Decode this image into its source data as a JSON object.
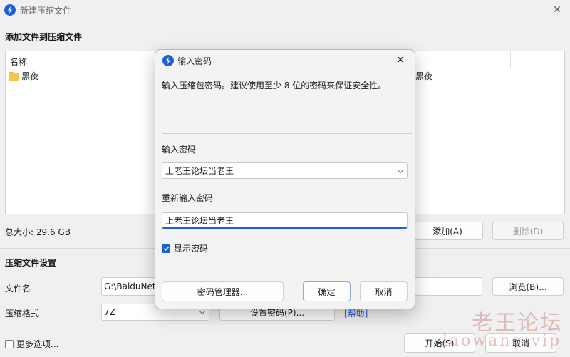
{
  "window": {
    "title": "新建压缩文件"
  },
  "add_section": {
    "heading": "添加文件到压缩文件",
    "columns": [
      "名称"
    ],
    "files": [
      {
        "name": "黑夜",
        "name_right": "黑夜"
      }
    ],
    "total_size": "总大小: 29.6 GB",
    "add_button": "添加(A)",
    "delete_button": "删除(D)"
  },
  "settings": {
    "heading": "压缩文件设置",
    "filename_label": "文件名",
    "filename_value": "G:\\BaiduNet",
    "browse_button": "浏览(B)...",
    "format_label": "压缩格式",
    "format_value": "7Z",
    "set_password_button": "设置密码(P)...",
    "help_link": "[帮助]"
  },
  "footer": {
    "more_options": "更多选项...",
    "start_button": "开始(S)",
    "cancel_button": "取消"
  },
  "dialog": {
    "title": "输入密码",
    "description": "输入压缩包密码。建议使用至少 8 位的密码来保证安全性。",
    "password_label": "输入密码",
    "password_value": "上老王论坛当老王",
    "reenter_label": "重新输入密码",
    "reenter_value": "上老王论坛当老王",
    "show_password_label": "显示密码",
    "show_password_checked": true,
    "manager_button": "密码管理器...",
    "ok_button": "确定",
    "cancel_button": "取消"
  },
  "watermark": {
    "line1": "老王论坛",
    "line2": "laowang.vip"
  },
  "colors": {
    "accent": "#1e5fd6",
    "watermark": "#d78c8c"
  }
}
